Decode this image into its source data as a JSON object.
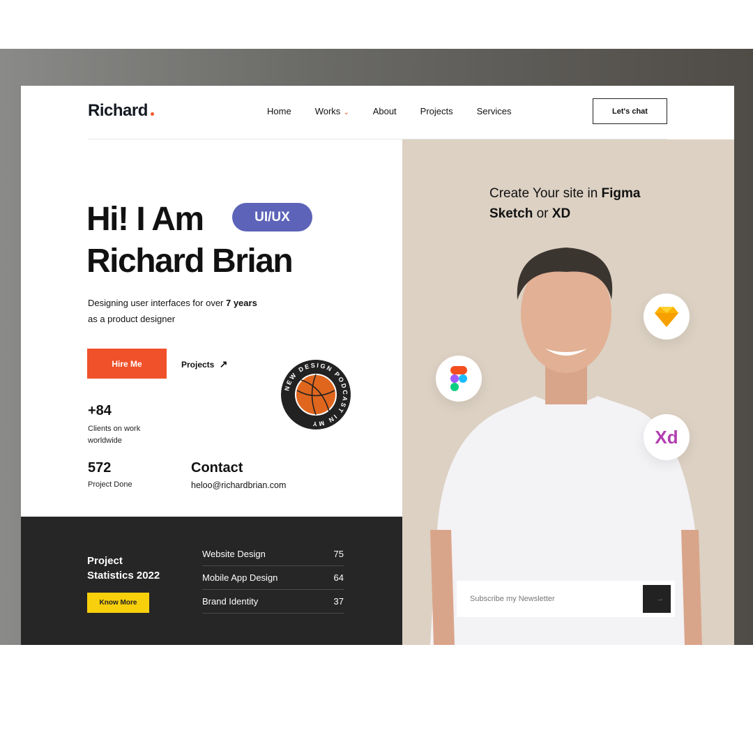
{
  "header": {
    "logo": "Richard",
    "nav": [
      "Home",
      "Works",
      "About",
      "Projects",
      "Services"
    ],
    "cta": "Let's chat"
  },
  "hero": {
    "line1": "Hi! I Am",
    "line2": "Richard Brian",
    "badge": "UI/UX",
    "desc_pre": "Designing user interfaces for over ",
    "desc_bold": "7 years",
    "desc_post": "as a product designer",
    "hire": "Hire Me",
    "projects": "Projects"
  },
  "stats": [
    {
      "value": "+84",
      "label": "Clients on work worldwide"
    },
    {
      "value": "572",
      "label": "Project Done"
    }
  ],
  "contact": {
    "title": "Contact",
    "email": "heloo@richardbrian.com"
  },
  "podcast": {
    "text": "NEW DESIGN PODCAST IN MY"
  },
  "statistics": {
    "title1": "Project",
    "title2": "Statistics 2022",
    "button": "Know More",
    "rows": [
      {
        "label": "Website Design",
        "value": "75"
      },
      {
        "label": "Mobile App Design",
        "value": "64"
      },
      {
        "label": "Brand Identity",
        "value": "37"
      }
    ]
  },
  "promo": {
    "pre": "Create Your site in ",
    "figma": "Figma",
    "sketch": "Sketch",
    "or": " or ",
    "xd": "XD"
  },
  "tools": {
    "xd_label": "Xd"
  },
  "newsletter": {
    "placeholder": "Subscribe my Newsletter"
  },
  "colors": {
    "accent": "#f0512a",
    "badge": "#5c63b8",
    "yellow": "#f8cf0b",
    "dark": "#262626",
    "beige": "#dcd1c3"
  }
}
